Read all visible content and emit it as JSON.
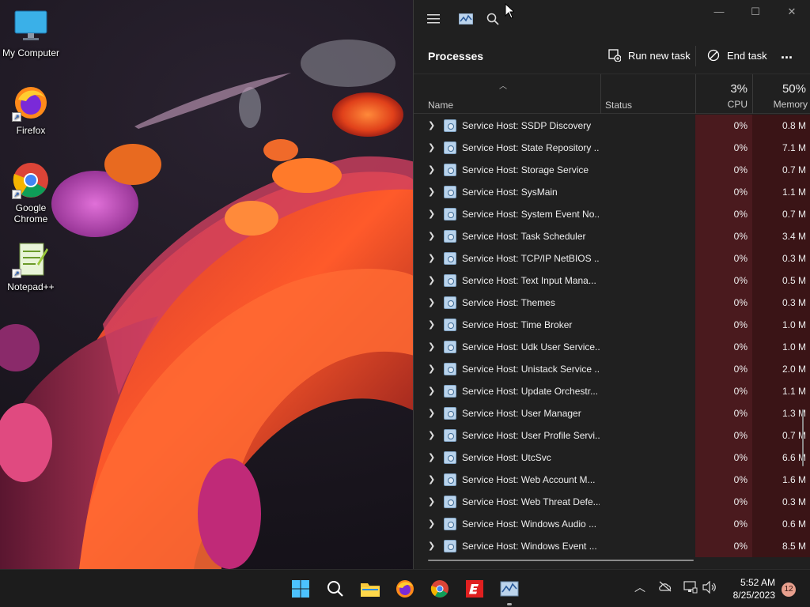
{
  "desktop": {
    "icons": [
      {
        "label": "My Computer",
        "icon": "monitor-icon"
      },
      {
        "label": "Firefox",
        "icon": "firefox-icon"
      },
      {
        "label": "Google Chrome",
        "icon": "chrome-icon"
      },
      {
        "label": "Notepad++",
        "icon": "notepad-plus-plus-icon"
      }
    ]
  },
  "task_manager": {
    "page_title": "Processes",
    "commands": {
      "run_new_task": "Run new task",
      "end_task": "End task",
      "more": "..."
    },
    "columns": {
      "name": "Name",
      "status": "Status",
      "cpu_label": "CPU",
      "cpu_total": "3%",
      "memory_label": "Memory",
      "memory_total": "50%"
    },
    "rows": [
      {
        "name": "Service Host: SSDP Discovery",
        "cpu": "0%",
        "memory": "0.8 M"
      },
      {
        "name": "Service Host: State Repository ...",
        "cpu": "0%",
        "memory": "7.1 M"
      },
      {
        "name": "Service Host: Storage Service",
        "cpu": "0%",
        "memory": "0.7 M"
      },
      {
        "name": "Service Host: SysMain",
        "cpu": "0%",
        "memory": "1.1 M"
      },
      {
        "name": "Service Host: System Event No...",
        "cpu": "0%",
        "memory": "0.7 M"
      },
      {
        "name": "Service Host: Task Scheduler",
        "cpu": "0%",
        "memory": "3.4 M"
      },
      {
        "name": "Service Host: TCP/IP NetBIOS ...",
        "cpu": "0%",
        "memory": "0.3 M"
      },
      {
        "name": "Service Host: Text Input Mana...",
        "cpu": "0%",
        "memory": "0.5 M"
      },
      {
        "name": "Service Host: Themes",
        "cpu": "0%",
        "memory": "0.3 M"
      },
      {
        "name": "Service Host: Time Broker",
        "cpu": "0%",
        "memory": "1.0 M"
      },
      {
        "name": "Service Host: Udk User Service...",
        "cpu": "0%",
        "memory": "1.0 M"
      },
      {
        "name": "Service Host: Unistack Service ...",
        "cpu": "0%",
        "memory": "2.0 M"
      },
      {
        "name": "Service Host: Update Orchestr...",
        "cpu": "0%",
        "memory": "1.1 M"
      },
      {
        "name": "Service Host: User Manager",
        "cpu": "0%",
        "memory": "1.3 M"
      },
      {
        "name": "Service Host: User Profile Servi...",
        "cpu": "0%",
        "memory": "0.7 M"
      },
      {
        "name": "Service Host: UtcSvc",
        "cpu": "0%",
        "memory": "6.6 M"
      },
      {
        "name": "Service Host: Web Account M...",
        "cpu": "0%",
        "memory": "1.6 M"
      },
      {
        "name": "Service Host: Web Threat Defe...",
        "cpu": "0%",
        "memory": "0.3 M"
      },
      {
        "name": "Service Host: Windows Audio ...",
        "cpu": "0%",
        "memory": "0.6 M"
      },
      {
        "name": "Service Host: Windows Event ...",
        "cpu": "0%",
        "memory": "8.5 M"
      }
    ]
  },
  "taskbar": {
    "apps": [
      "start-icon",
      "search-icon",
      "file-explorer-icon",
      "firefox-icon",
      "chrome-icon",
      "app-e-icon",
      "task-manager-icon"
    ],
    "clock": {
      "time": "5:52 AM",
      "date": "8/25/2023"
    },
    "notification_count": "12"
  },
  "colors": {
    "window_bg": "#202020",
    "cpu_heat": "#4a1a1e",
    "memory_heat": "#3a1416",
    "taskbar_bg": "#1c1c1c"
  }
}
